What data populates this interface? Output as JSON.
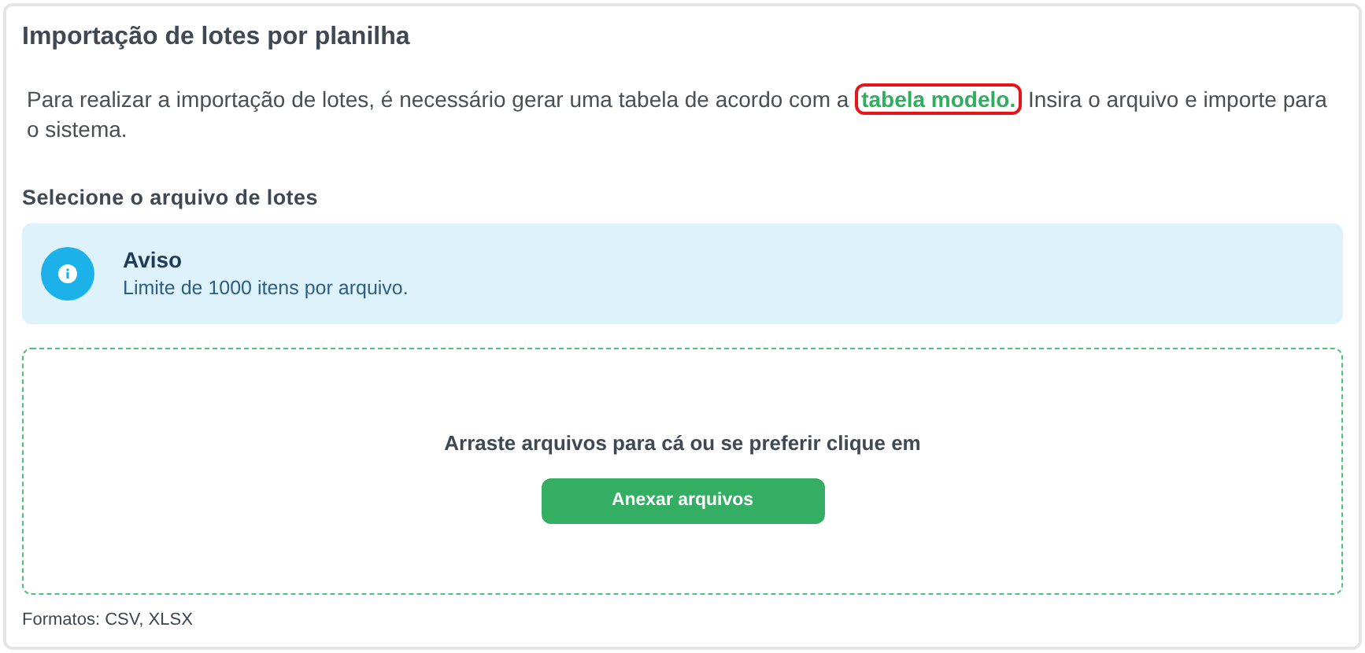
{
  "title": "Importação de lotes por planilha",
  "intro": {
    "before": "Para realizar a importação de lotes, é necessário gerar uma tabela de acordo com a",
    "link": {
      "label": "tabela modelo.",
      "highlighted": true
    },
    "after": "Insira o arquivo e importe para o sistema."
  },
  "section_heading": "Selecione o arquivo de lotes",
  "alert": {
    "kind": "info",
    "title": "Aviso",
    "message": "Limite de 1000 itens por arquivo."
  },
  "dropzone": {
    "prompt": "Arraste arquivos para cá ou se preferir clique em",
    "button": "Anexar arquivos"
  },
  "formats": "Formatos: CSV, XLSX"
}
